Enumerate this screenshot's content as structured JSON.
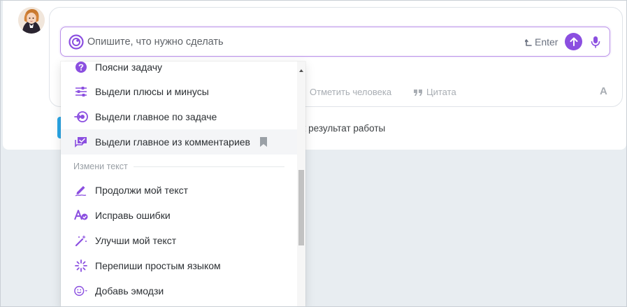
{
  "composer": {
    "placeholder": "Опишите, что нужно сделать",
    "enter_hint": "Enter",
    "send_icon": "arrow-up-icon",
    "mic_icon": "microphone-icon"
  },
  "toolbar": {
    "mark_person": "Отметить человека",
    "quote": "Цитата",
    "font_label": "A"
  },
  "bottom": {
    "result_text": "ак результат работы"
  },
  "menu": {
    "items_top": [
      {
        "label": "Поясни задачу",
        "icon": "question-icon"
      },
      {
        "label": "Выдели плюсы и минусы",
        "icon": "sliders-icon"
      },
      {
        "label": "Выдели главное по задаче",
        "icon": "target-arrow-icon"
      },
      {
        "label": "Выдели главное из комментариев",
        "icon": "comments-icon"
      }
    ],
    "section_title": "Измени текст",
    "items_bottom": [
      {
        "label": "Продолжи мой текст",
        "icon": "pen-icon"
      },
      {
        "label": "Исправь ошибки",
        "icon": "spellcheck-icon"
      },
      {
        "label": "Улучши мой текст",
        "icon": "magic-wand-icon"
      },
      {
        "label": "Перепиши простым языком",
        "icon": "sparkle-icon"
      },
      {
        "label": "Добавь эмодзи",
        "icon": "emoji-icon"
      }
    ]
  },
  "colors": {
    "accent": "#8b4fe0",
    "icon": "#8b4fe0",
    "input_border": "#b88ee8",
    "blue_button": "#2aa7e6"
  }
}
